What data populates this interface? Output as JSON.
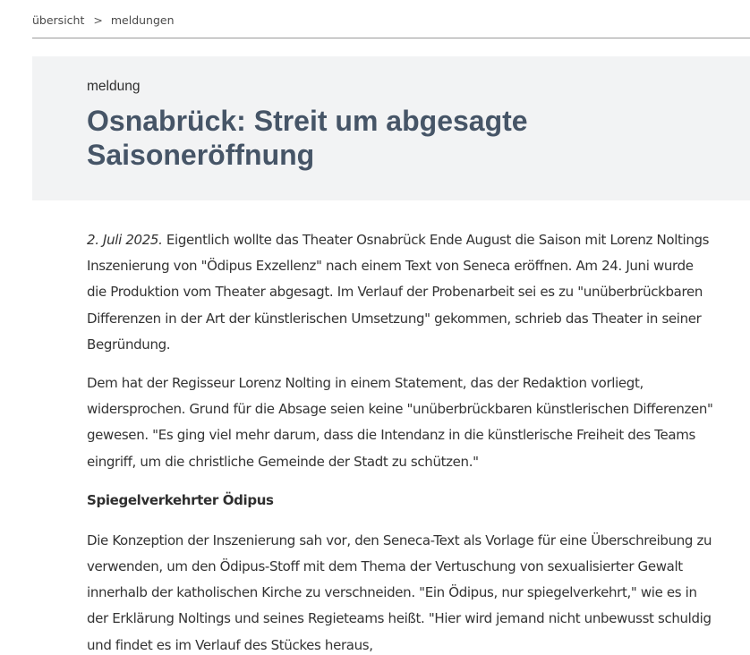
{
  "breadcrumb": {
    "items": [
      "übersicht",
      "meldungen"
    ],
    "separator": ">"
  },
  "hero": {
    "kicker": "meldung",
    "title": "Osnabrück: Streit um abgesagte Saisoneröffnung"
  },
  "article": {
    "date": "2. Juli 2025.",
    "paragraph1": " Eigentlich wollte das Theater Osnabrück Ende August die Saison mit Lorenz Noltings Inszenierung von \"Ödipus Exzellenz\" nach einem Text von Seneca eröffnen. Am 24. Juni wurde die Produktion vom Theater abgesagt. Im Verlauf der Probenarbeit sei es zu \"unüberbrückbaren Differenzen in der Art der künstlerischen Umsetzung\" gekommen, schrieb das Theater in seiner Begründung.",
    "paragraph2": "Dem hat der Regisseur Lorenz Nolting in einem Statement, das der Redaktion vorliegt, widersprochen. Grund für die Absage seien keine \"unüberbrückbaren künstlerischen Differenzen\" gewesen. \"Es ging viel mehr darum, dass die Intendanz in die künstlerische Freiheit des Teams eingriff, um die christliche Gemeinde der Stadt zu schützen.\"",
    "subheading": "Spiegelverkehrter Ödipus",
    "paragraph3": "Die Konzeption der Inszenierung sah vor, den Seneca-Text als Vorlage für eine Überschreibung zu verwenden, um den Ödipus-Stoff mit dem Thema der Vertuschung von sexualisierter Gewalt innerhalb der katholischen Kirche zu verschneiden. \"Ein Ödipus, nur spiegelverkehrt,\" wie es in der Erklärung Noltings und seines Regieteams heißt. \"Hier wird jemand nicht unbewusst schuldig und findet es im Verlauf des Stückes heraus,"
  },
  "colors": {
    "title": "#465567",
    "hero_background": "#f2f3f4",
    "text": "#333333",
    "divider": "#9a9a9a"
  }
}
